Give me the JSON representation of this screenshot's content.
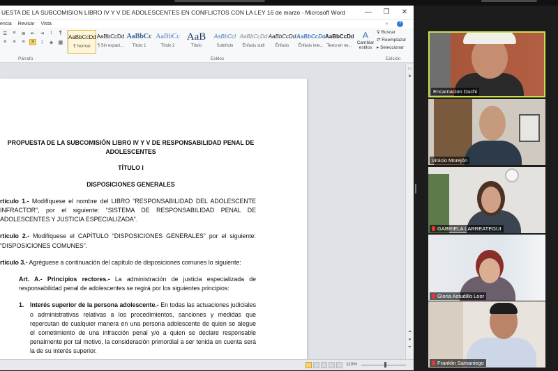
{
  "word": {
    "window_title": "UESTA DE LA SUBCOMISION LIBRO IV Y V DE ADOLESCENTES EN CONFLICTOS CON LA LEY  16 de marzo  -  Microsoft Word",
    "controls": {
      "minimize": "—",
      "maximize": "❐",
      "close": "✕"
    },
    "tabs": [
      "encia",
      "Revisar",
      "Vista"
    ],
    "ribbon": {
      "paragraph_label": "Párrafo",
      "styles_label": "Estilos",
      "editing_label": "Edición",
      "styles": [
        {
          "sample": "AaBbCcDd",
          "name": "¶ Normal"
        },
        {
          "sample": "AaBbCcDd",
          "name": "¶ Sin espaci..."
        },
        {
          "sample": "AaBbCc",
          "name": "Título 1"
        },
        {
          "sample": "AaBbCc",
          "name": "Título 2"
        },
        {
          "sample": "AaB",
          "name": "Título"
        },
        {
          "sample": "AaBbCcI",
          "name": "Subtítulo"
        },
        {
          "sample": "AaBbCcDd",
          "name": "Énfasis sutil"
        },
        {
          "sample": "AaBbCcDd",
          "name": "Énfasis"
        },
        {
          "sample": "AaBbCcDd",
          "name": "Énfasis inte..."
        },
        {
          "sample": "AaBbCcDd",
          "name": "Texto en ne..."
        }
      ],
      "change_styles": "Cambiar estilos",
      "find": "Buscar",
      "replace": "Reemplazar",
      "select": "Seleccionar"
    },
    "document": {
      "heading1": "PROPUESTA DE LA SUBCOMISIÓN LIBRO IV Y V DE RESPONSABILIDAD PENAL DE ADOLESCENTES",
      "heading2": "TÍTULO I",
      "heading3": "DISPOSICIONES GENERALES",
      "art1_label": "rtículo 1.-",
      "art1_text": " Modifíquese el nombre del LIBRO  “RESPONSABILIDAD DEL ADOLESCENTE INFRACTOR”, por el siguiente: “SISTEMA DE RESPONSABILIDAD PENAL DE ADOLESCENTES Y JUSTICIA ESPECIALIZADA”.",
      "art2_label": "rtículo 2.-",
      "art2_text": " Modifíquese el CAPÍTULO “DISPOSICIONES GENERALES” por el siguiente: “DISPOSICIONES COMUNES”.",
      "art3_label": "rtículo 3.-",
      "art3_text": " Agréguese a continuación del capítulo de disposiciones comunes lo siguiente:",
      "artA_label": "Art. A.-  Principios rectores.-",
      "artA_text": " La administración de justicia especializada de responsabilidad penal de adolescentes se regirá por los siguientes principios:",
      "item1_num": "1.",
      "item1_label": "Interés superior de la persona adolescente.-",
      "item1_text": " En todas las actuaciones judiciales o administrativas relativas a los procedimientos, sanciones y medidas que repercutan de cualquier manera en una persona adolescente de quien se alegue el cometimiento de una infracción penal y/o a quien se declare responsable penalmente por tal motivo, la consideración primordial a ser tenida en cuenta será la de su interés superior."
    },
    "statusbar": {
      "zoom": "110%"
    }
  },
  "participants": [
    {
      "name": "Encarnacion Duchi",
      "active": true,
      "muted": false
    },
    {
      "name": "Vinicio Morejón",
      "active": false,
      "muted": false
    },
    {
      "name": "GABRIELA LARREATEGUI",
      "active": false,
      "muted": true
    },
    {
      "name": "Gloria Astudillo Loor",
      "active": false,
      "muted": true
    },
    {
      "name": "Franklin Samaniego",
      "active": false,
      "muted": true
    }
  ]
}
